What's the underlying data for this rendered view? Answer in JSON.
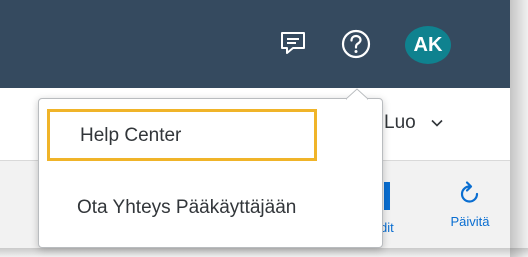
{
  "shellbar": {
    "avatar_initials": "AK",
    "icons": {
      "notifications": "message-icon",
      "help": "help-icon"
    }
  },
  "header": {
    "create_label": "Luo"
  },
  "toolbar": {
    "edit_label": "dit",
    "refresh_label": "Päivitä"
  },
  "help_menu": {
    "items": [
      {
        "label": "Help Center",
        "highlighted": true
      },
      {
        "label": "Ota Yhteys Pääkäyttäjään",
        "highlighted": false
      }
    ]
  },
  "colors": {
    "shellbar_bg": "#354a5f",
    "avatar_bg": "#0f828f",
    "accent": "#0a6ed1",
    "highlight_border": "#f0b429"
  }
}
